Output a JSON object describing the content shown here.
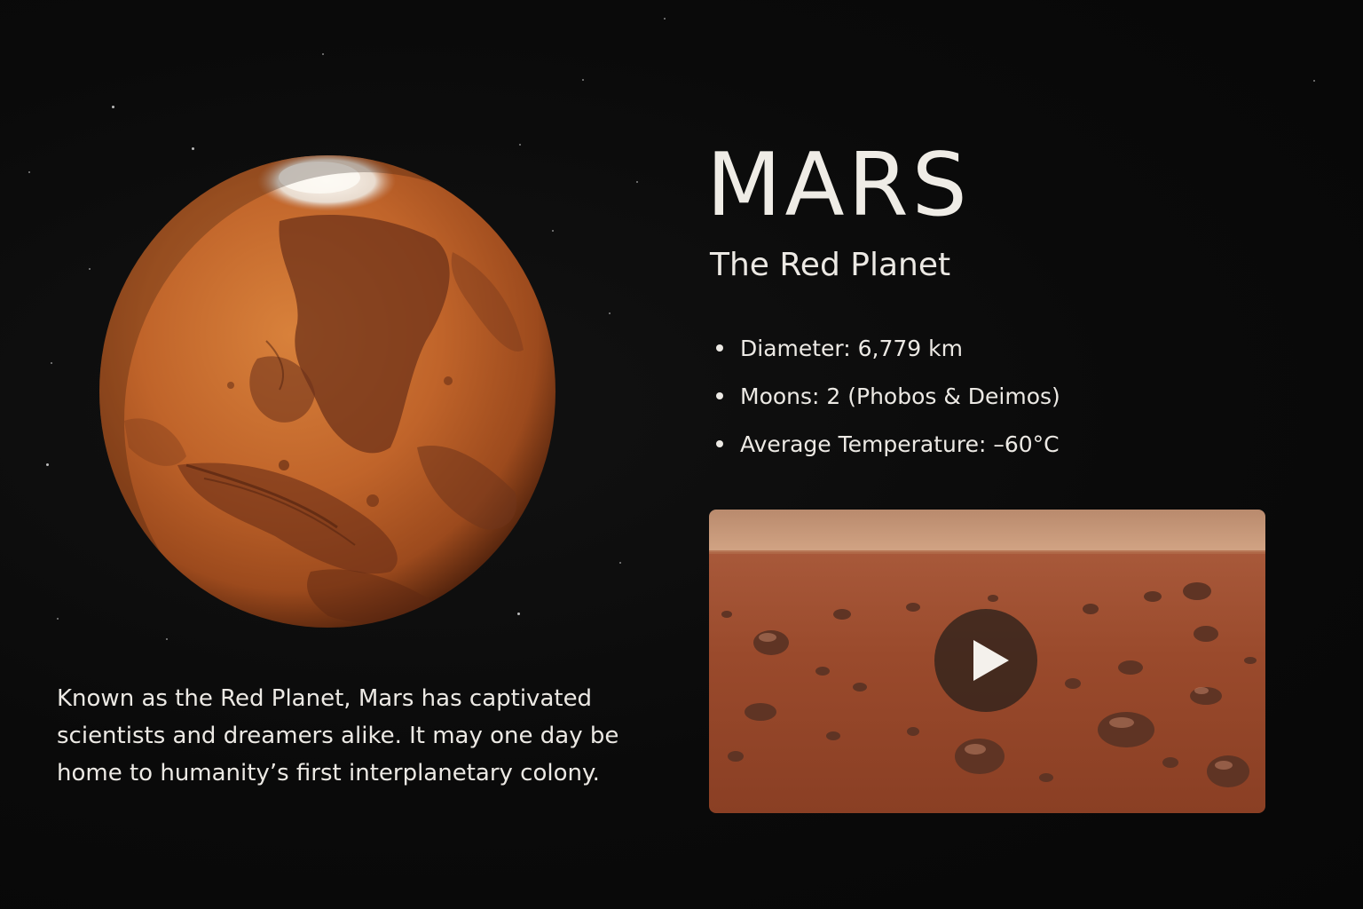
{
  "planet": {
    "name": "MARS",
    "tagline": "The Red Planet",
    "image_icon": "mars-globe"
  },
  "facts": [
    "Diameter: 6,779 km",
    "Moons: 2 (Phobos & Deimos)",
    "Average Temperature: –60°C"
  ],
  "description": "Known as the Red Planet, Mars has captivated scientists and dreamers alike. It may one day be home to humanity’s first interplanetary colony.",
  "video": {
    "thumbnail_icon": "mars-surface-landscape",
    "play_icon": "play-icon"
  },
  "colors": {
    "background": "#0a0a0a",
    "text": "#ece9e4",
    "planet": "#c0642a",
    "surface": "#9a4a2c",
    "sky": "#c99a76"
  }
}
